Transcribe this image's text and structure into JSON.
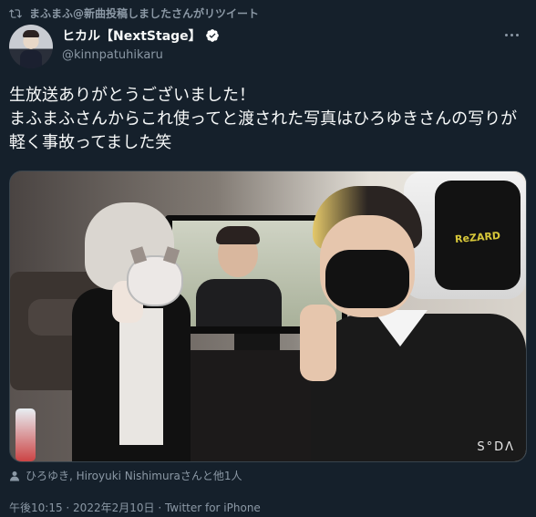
{
  "retweet": {
    "text": "まふまふ@新曲投稿しましたさんがリツイート",
    "icon": "retweet-icon"
  },
  "author": {
    "name": "ヒカル【NextStage】",
    "handle": "@kinnpatuhikaru",
    "verified": true,
    "verified_color": "#ffffff"
  },
  "tweet": {
    "text": "生放送ありがとうございました！\nまふまふさんからこれ使ってと渡された写真はひろゆきさんの写りが軽く事故ってました笑"
  },
  "photo": {
    "watermark": "S°DΛ",
    "chair_logo": "ReZARD"
  },
  "tagged": {
    "text": "ひろゆき, Hiroyuki Nishimuraさんと他1人",
    "icon": "user-icon"
  },
  "meta": {
    "time": "午後10:15",
    "date": "2022年2月10日",
    "source": "Twitter for iPhone",
    "separator": " · "
  },
  "colors": {
    "background": "#15202b",
    "text": "#f7f9f9",
    "secondary": "#8b98a5"
  }
}
